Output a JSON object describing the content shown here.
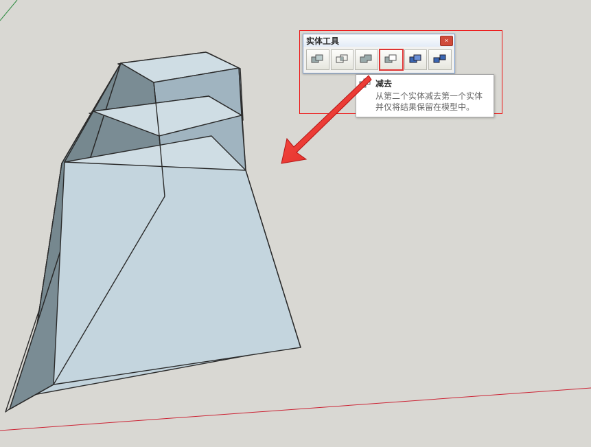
{
  "toolbar": {
    "title": "实体工具",
    "close_label": "×",
    "buttons": [
      {
        "name": "outer-shell",
        "highlight": false
      },
      {
        "name": "intersect",
        "highlight": false
      },
      {
        "name": "union",
        "highlight": false
      },
      {
        "name": "subtract",
        "highlight": true
      },
      {
        "name": "trim",
        "highlight": false
      },
      {
        "name": "split",
        "highlight": false
      }
    ]
  },
  "tooltip": {
    "title": "减去",
    "description": "从第二个实体减去第一个实体并仅将结果保留在模型中。"
  },
  "colors": {
    "model_face_light": "#c2d3dc",
    "model_face_mid": "#a6bbc7",
    "model_face_dark": "#7c8e97",
    "model_edge": "#333",
    "ground": "#d9d8d3",
    "axis_red": "#c23",
    "axis_green": "#2b8a3e",
    "annot_red": "#e11"
  }
}
